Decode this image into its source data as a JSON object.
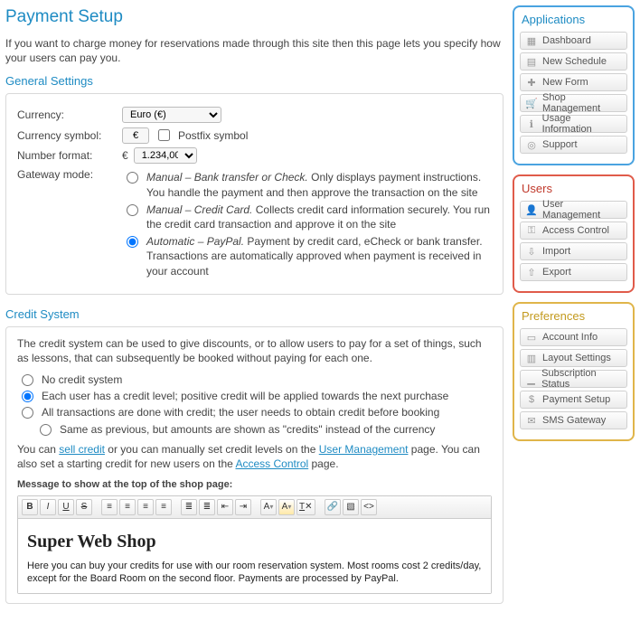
{
  "page": {
    "title": "Payment Setup",
    "intro": "If you want to charge money for reservations made through this site then this page lets you specify how your users can pay you."
  },
  "general": {
    "heading": "General Settings",
    "currency_label": "Currency:",
    "currency_value": "Euro (€)",
    "symbol_label": "Currency symbol:",
    "symbol_value": "€",
    "postfix_label": "Postfix symbol",
    "numfmt_label": "Number format:",
    "numfmt_prefix": "€",
    "numfmt_value": "1.234,00",
    "gateway_label": "Gateway mode:",
    "modes": [
      {
        "title": "Manual – Bank transfer or Check.",
        "desc": "Only displays payment instructions. You handle the payment and then approve the transaction on the site",
        "selected": false
      },
      {
        "title": "Manual – Credit Card.",
        "desc": "Collects credit card information securely. You run the credit card transaction and approve it on the site",
        "selected": false
      },
      {
        "title": "Automatic – PayPal.",
        "desc": "Payment by credit card, eCheck or bank transfer. Transactions are automatically approved when payment is received in your account",
        "selected": true
      }
    ]
  },
  "credit": {
    "heading": "Credit System",
    "intro": "The credit system can be used to give discounts, or to allow users to pay for a set of things, such as lessons, that can subsequently be booked without paying for each one.",
    "options": [
      {
        "label": "No credit system",
        "selected": false
      },
      {
        "label": "Each user has a credit level; positive credit will be applied towards the next purchase",
        "selected": true
      },
      {
        "label": "All transactions are done with credit; the user needs to obtain credit before booking",
        "selected": false
      },
      {
        "label": "Same as previous, but amounts are shown as \"credits\" instead of the currency",
        "selected": false
      }
    ],
    "note_pre": "You can ",
    "link_sell": "sell credit",
    "note_mid": " or you can manually set credit levels on the ",
    "link_users": "User Management",
    "note_post": " page. You can also set a starting credit for new users on the ",
    "link_access": "Access Control",
    "note_end": " page.",
    "msg_label": "Message to show at the top of the shop page:",
    "editor_title": "Super Web Shop",
    "editor_body": "Here you can buy your credits for use with our room reservation system. Most rooms cost 2 credits/day, except for the Board Room on the second floor. Payments are processed by PayPal."
  },
  "editor_toolbar": [
    "B",
    "I",
    "U",
    "S",
    "align-left",
    "align-center",
    "align-right",
    "align-justify",
    "list-ul",
    "list-ol",
    "outdent",
    "indent",
    "text-color",
    "bg-color",
    "clear",
    "link",
    "image",
    "source"
  ],
  "sidebar": {
    "apps": {
      "title": "Applications",
      "items": [
        "Dashboard",
        "New Schedule",
        "New Form",
        "Shop Management",
        "Usage Information",
        "Support"
      ],
      "icons": [
        "grid-icon",
        "calendar-icon",
        "plus-icon",
        "cart-icon",
        "info-icon",
        "life-ring-icon"
      ]
    },
    "users": {
      "title": "Users",
      "items": [
        "User Management",
        "Access Control",
        "Import",
        "Export"
      ],
      "icons": [
        "person-icon",
        "key-icon",
        "import-icon",
        "export-icon"
      ]
    },
    "prefs": {
      "title": "Preferences",
      "items": [
        "Account Info",
        "Layout Settings",
        "Subscription Status",
        "Payment Setup",
        "SMS Gateway"
      ],
      "icons": [
        "card-icon",
        "layout-icon",
        "signal-icon",
        "money-icon",
        "chat-icon"
      ]
    }
  }
}
